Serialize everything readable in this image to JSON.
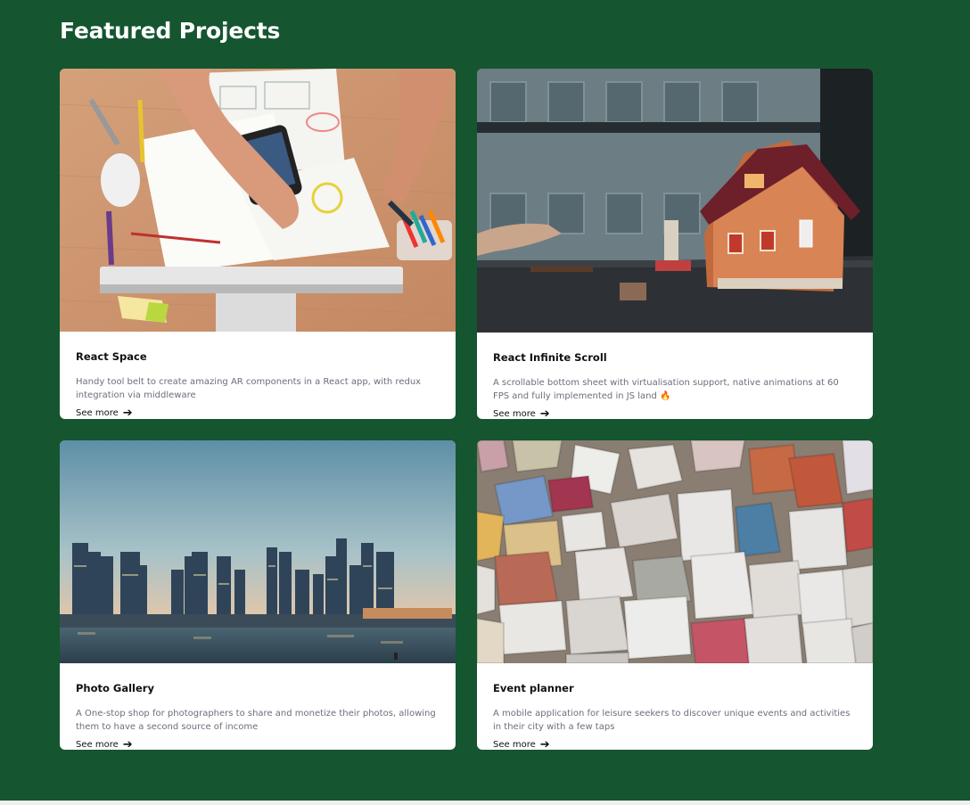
{
  "section": {
    "title": "Featured Projects"
  },
  "projects": [
    {
      "title": "React Space",
      "description": "Handy tool belt to create amazing AR components in a React app, with redux integration via middleware",
      "link_label": "See more",
      "image": "desk-workspace-photo"
    },
    {
      "title": "React Infinite Scroll",
      "description": "A scrollable bottom sheet with virtualisation support, native animations at 60 FPS and fully implemented in JS land 🔥",
      "link_label": "See more",
      "image": "dollhouse-photo"
    },
    {
      "title": "Photo Gallery",
      "description": "A One-stop shop for photographers to share and monetize their photos, allowing them to have a second source of income",
      "link_label": "See more",
      "image": "city-skyline-photo"
    },
    {
      "title": "Event planner",
      "description": "A mobile application for leisure seekers to discover unique events and activities in their city with a few taps",
      "link_label": "See more",
      "image": "colored-stones-photo"
    }
  ],
  "colors": {
    "background": "#155530",
    "card": "#ffffff",
    "title": "#111111",
    "description": "#6b6f7b"
  },
  "icons": {
    "see_more": "arrow-right-icon"
  }
}
